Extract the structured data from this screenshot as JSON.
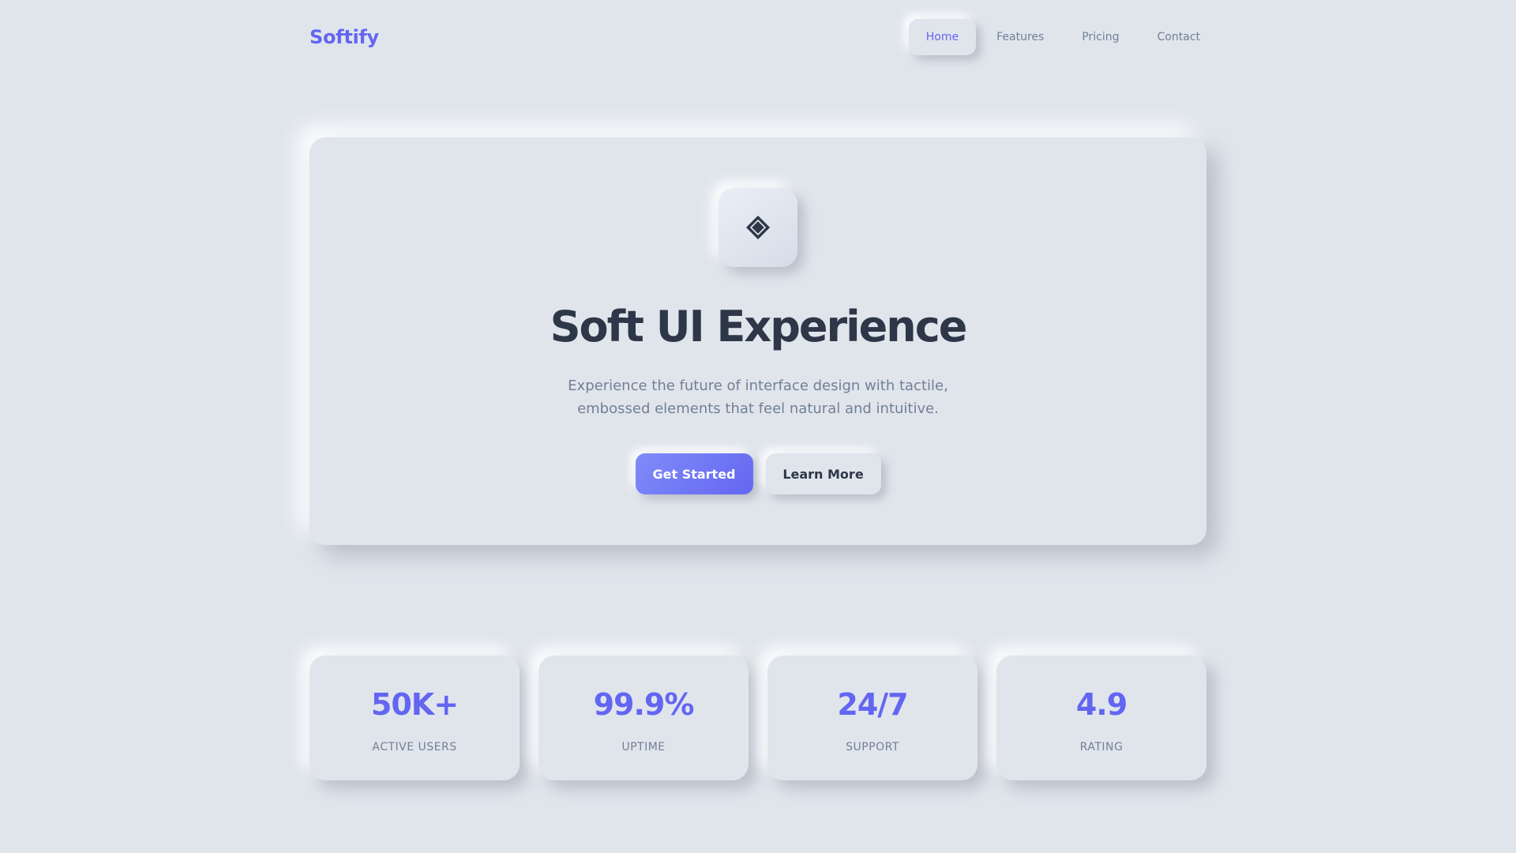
{
  "brand": {
    "name": "Softify",
    "accent": "#6366f1",
    "background": "#e0e5ec"
  },
  "nav": {
    "items": [
      {
        "label": "Home",
        "active": true
      },
      {
        "label": "Features",
        "active": false
      },
      {
        "label": "Pricing",
        "active": false
      },
      {
        "label": "Contact",
        "active": false
      }
    ]
  },
  "hero": {
    "icon": "diamond-icon",
    "title": "Soft UI Experience",
    "subtitle_line1": "Experience the future of interface design with tactile,",
    "subtitle_line2": "embossed elements that feel natural and intuitive.",
    "primary_button": "Get Started",
    "secondary_button": "Learn More"
  },
  "stats": [
    {
      "value": "50K+",
      "label": "ACTIVE USERS"
    },
    {
      "value": "99.9%",
      "label": "UPTIME"
    },
    {
      "value": "24/7",
      "label": "SUPPORT"
    },
    {
      "value": "4.9",
      "label": "RATING"
    }
  ]
}
